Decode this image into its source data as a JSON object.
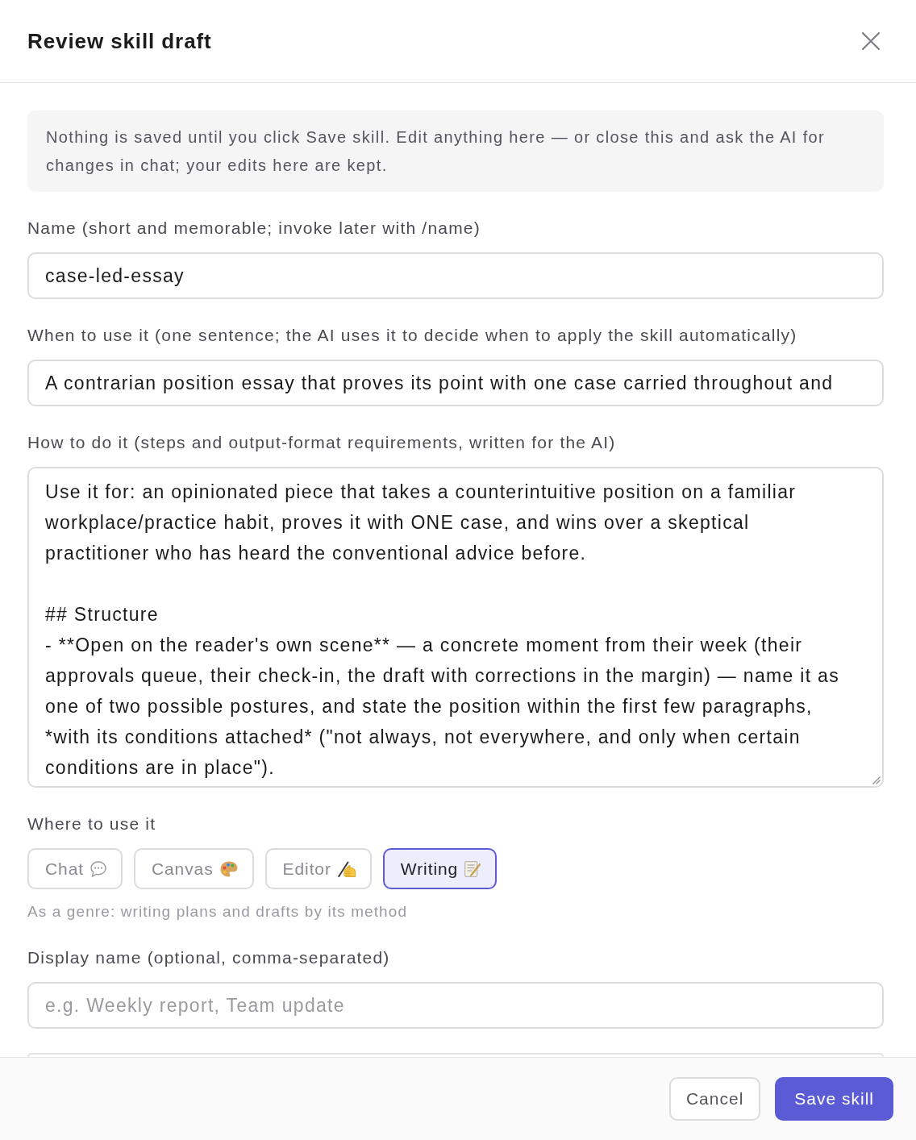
{
  "dialog": {
    "title": "Review skill draft"
  },
  "notice": "Nothing is saved until you click Save skill. Edit anything here — or close this and ask the AI for changes in chat; your edits here are kept.",
  "fields": [
    {
      "kind": "input",
      "label": "Name (short and memorable; invoke later with /name)",
      "value": "case-led-essay"
    },
    {
      "kind": "input",
      "label": "When to use it (one sentence; the AI uses it to decide when to apply the skill automatically)",
      "value": "A contrarian position essay that proves its point with one case carried throughout and"
    },
    {
      "kind": "textarea",
      "label": "How to do it (steps and output-format requirements, written for the AI)",
      "value": "Use it for: an opinionated piece that takes a counterintuitive position on a familiar workplace/practice habit, proves it with ONE case, and wins over a skeptical practitioner who has heard the conventional advice before.\n\n## Structure\n- **Open on the reader's own scene** — a concrete moment from their week (their approvals queue, their check-in, the draft with corrections in the margin) — name it as one of two possible postures, and state the position within the first few paragraphs, *with its conditions attached* (\"not always, not everywhere, and only when certain conditions are in place\")."
    },
    {
      "kind": "choices",
      "label": "Where to use it",
      "options": [
        {
          "label": "Chat",
          "kind": "chat",
          "selected": false
        },
        {
          "label": "Canvas",
          "kind": "canvas",
          "selected": false
        },
        {
          "label": "Editor",
          "kind": "editor",
          "selected": false
        },
        {
          "label": "Writing",
          "kind": "writing",
          "selected": true
        }
      ],
      "hint": "As a genre: writing plans and drafts by its method"
    },
    {
      "kind": "input",
      "label": "Display name (optional, comma-separated)",
      "placeholder": "e.g. Weekly report, Team update"
    },
    {
      "kind": "cut_off_input"
    }
  ],
  "buttons": [
    {
      "label": "Cancel",
      "kind": "secondary"
    },
    {
      "label": "Save skill",
      "kind": "primary"
    }
  ]
}
